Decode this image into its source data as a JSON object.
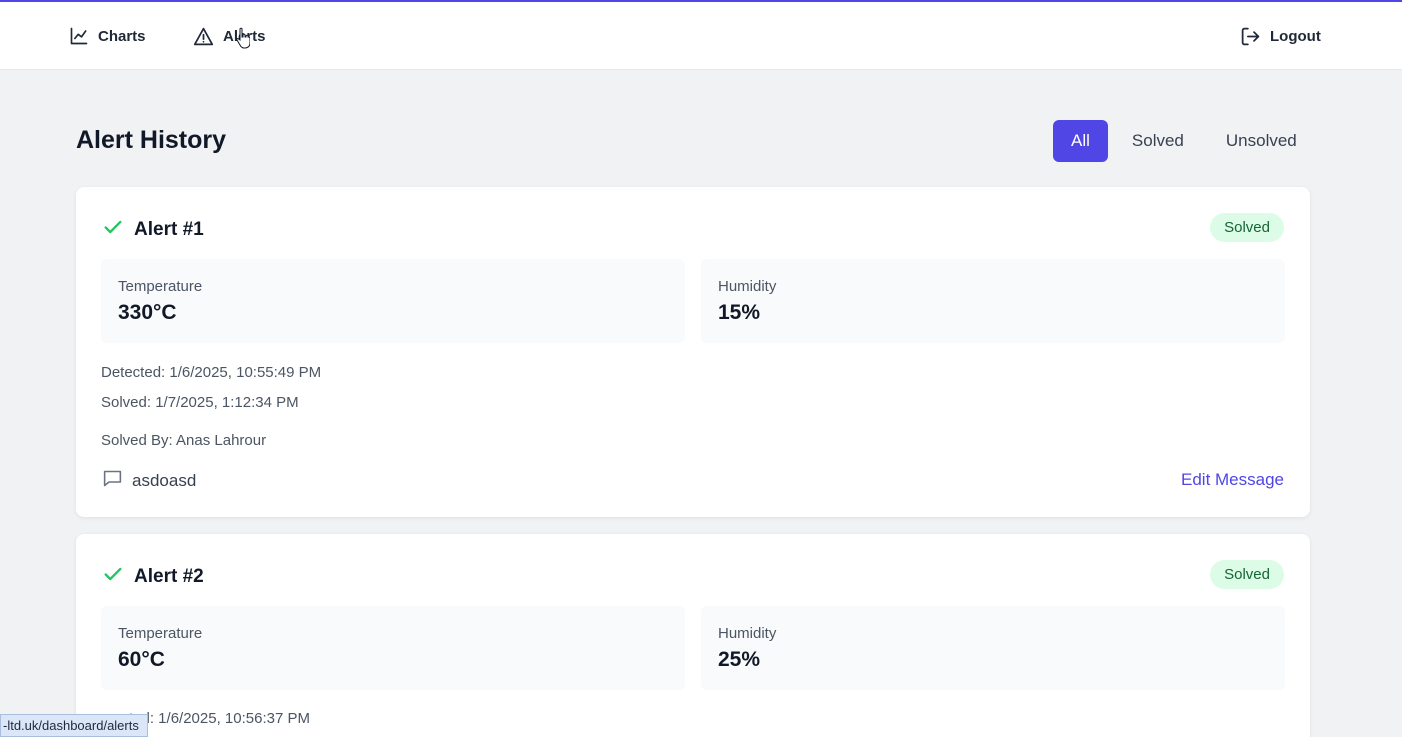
{
  "colors": {
    "accent": "#4f46e5",
    "success": "#22c55e",
    "badge_bg": "#dcfce7",
    "badge_text": "#166534"
  },
  "nav": {
    "charts": {
      "label": "Charts",
      "icon": "line-chart-icon"
    },
    "alerts": {
      "label": "Alerts",
      "icon": "warning-triangle-icon"
    },
    "logout": {
      "label": "Logout",
      "icon": "logout-icon"
    }
  },
  "page": {
    "title": "Alert History",
    "filters": [
      "All",
      "Solved",
      "Unsolved"
    ],
    "active_filter": "All"
  },
  "alerts": [
    {
      "title": "Alert #1",
      "status": "Solved",
      "temperature_label": "Temperature",
      "temperature": "330°C",
      "humidity_label": "Humidity",
      "humidity": "15%",
      "detected": "Detected: 1/6/2025, 10:55:49 PM",
      "solved": "Solved: 1/7/2025, 1:12:34 PM",
      "solved_by": "Solved By: Anas Lahrour",
      "message": "asdoasd",
      "edit_label": "Edit Message"
    },
    {
      "title": "Alert #2",
      "status": "Solved",
      "temperature_label": "Temperature",
      "temperature": "60°C",
      "humidity_label": "Humidity",
      "humidity": "25%",
      "detected": "ted: 1/6/2025, 10:56:37 PM"
    }
  ],
  "status_bar": {
    "url": "-ltd.uk/dashboard/alerts"
  }
}
